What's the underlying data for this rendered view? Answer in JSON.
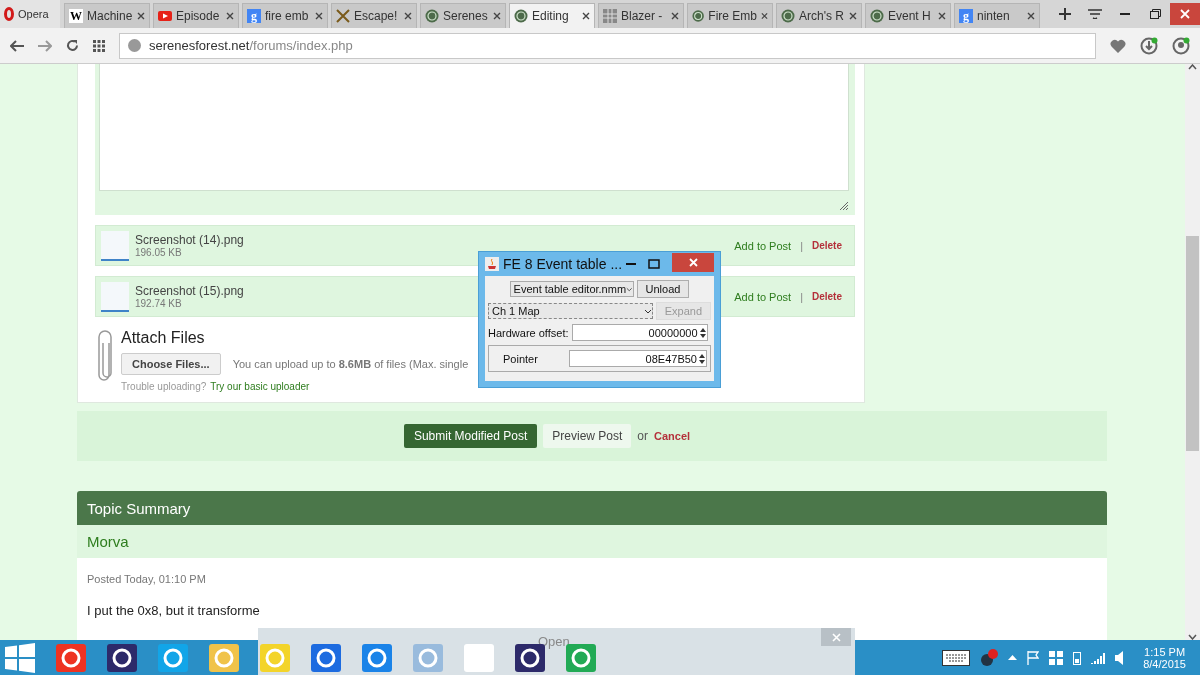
{
  "browser": {
    "menu_label": "Opera",
    "tabs": [
      {
        "label": "Machine",
        "kind": "letter",
        "glyph": "W",
        "selected": false
      },
      {
        "label": "Episode",
        "kind": "video",
        "selected": false
      },
      {
        "label": "fire emb",
        "kind": "letter",
        "glyph": "g",
        "selected": false
      },
      {
        "label": "Escape!",
        "kind": "sword",
        "selected": false
      },
      {
        "label": "Serenes",
        "kind": "emblem",
        "selected": false
      },
      {
        "label": "Editing",
        "kind": "emblem",
        "selected": true
      },
      {
        "label": "Blazer -",
        "kind": "grid",
        "selected": false
      },
      {
        "label": "Fire Emb",
        "kind": "emblem",
        "selected": false
      },
      {
        "label": "Arch's R",
        "kind": "emblem",
        "selected": false
      },
      {
        "label": "Event H",
        "kind": "emblem",
        "selected": false
      },
      {
        "label": "ninten",
        "kind": "letter",
        "glyph": "g",
        "selected": false
      }
    ],
    "address": {
      "host": "serenesforest.net",
      "path": "/forums/index.php"
    }
  },
  "page": {
    "attachments": [
      {
        "name": "Screenshot (14).png",
        "size": "196.05 KB",
        "add": "Add to Post",
        "separator": "|",
        "delete": "Delete"
      },
      {
        "name": "Screenshot (15).png",
        "size": "192.74 KB",
        "add": "Add to Post",
        "separator": "|",
        "delete": "Delete"
      }
    ],
    "attach": {
      "title": "Attach Files",
      "button": "Choose Files...",
      "note": "You can upload up to **8.6MB** of files (Max. single",
      "trouble": "Trouble uploading?",
      "link": "Try our basic uploader"
    },
    "actions": {
      "submit": "Submit Modified Post",
      "preview": "Preview Post",
      "or": "or",
      "cancel": "Cancel"
    },
    "topic_summary": {
      "title": "Topic Summary",
      "author": "Morva",
      "posted": "Posted Today, 01:10 PM",
      "text": "I put the 0x8, but it transforme"
    }
  },
  "dialog": {
    "title": "FE 8 Event table ...",
    "file_select": "Event table editor.nmm",
    "unload": "Unload",
    "map_select": "Ch 1 Map",
    "expand": "Expand",
    "hardware_label": "Hardware offset:",
    "hardware_value": "00000000",
    "pointer_label": "Pointer",
    "pointer_value": "08E47B50"
  },
  "preview": {
    "title": "Open"
  },
  "taskbar": {
    "time": "1:15 PM",
    "date": "8/4/2015"
  }
}
